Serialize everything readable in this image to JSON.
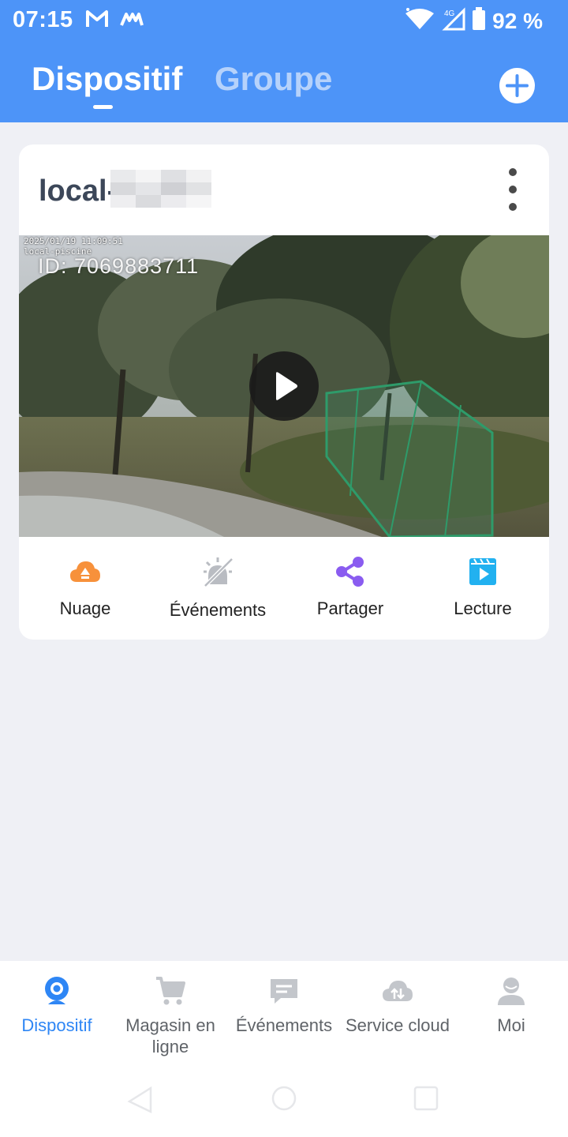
{
  "status_bar": {
    "time": "07:15",
    "battery": "92 %",
    "left_icons": [
      "gmail-icon",
      "app-notification-icon"
    ],
    "right_icons": [
      "wifi-icon",
      "signal-4g-icon",
      "battery-icon"
    ]
  },
  "header": {
    "tabs": [
      {
        "label": "Dispositif",
        "active": true
      },
      {
        "label": "Groupe",
        "active": false
      }
    ],
    "add_icon": "plus-circle-icon",
    "background": "#4d94f8"
  },
  "device_card": {
    "name": "local-",
    "name_redacted": true,
    "preview": {
      "timestamp": "2025/01/19 11:09:51",
      "camera_label": "local-piscine",
      "id_text": "ID: 7069883711"
    },
    "actions": [
      {
        "label": "Nuage",
        "icon": "cloud-upload-icon",
        "color": "#f7913b"
      },
      {
        "label": "Événements",
        "icon": "motion-alert-off-icon",
        "color": "#b9bcc2"
      },
      {
        "label": "Partager",
        "icon": "share-icon",
        "color": "#8a5cf0"
      },
      {
        "label": "Lecture",
        "icon": "playback-video-icon",
        "color": "#22b1f0"
      }
    ]
  },
  "bottom_nav": {
    "items": [
      {
        "label": "Dispositif",
        "icon": "camera-icon",
        "active": true
      },
      {
        "label": "Magasin en ligne",
        "icon": "cart-icon",
        "active": false
      },
      {
        "label": "Événements",
        "icon": "message-icon",
        "active": false
      },
      {
        "label": "Service cloud",
        "icon": "cloud-service-icon",
        "active": false
      },
      {
        "label": "Moi",
        "icon": "profile-icon",
        "active": false
      }
    ],
    "active_color": "#2e86f5"
  }
}
